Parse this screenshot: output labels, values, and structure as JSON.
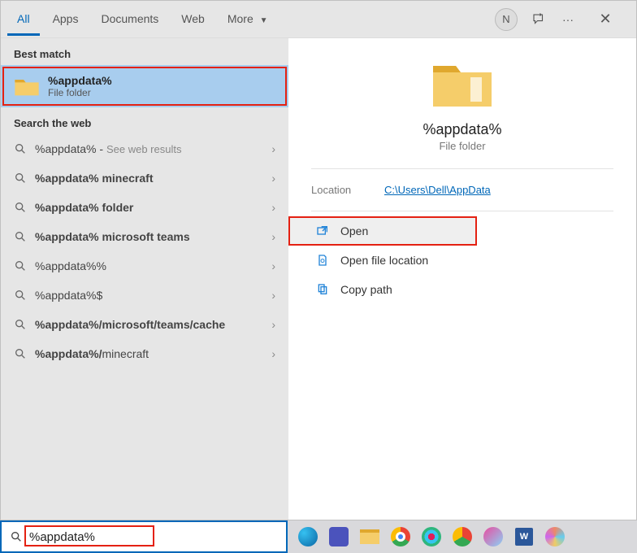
{
  "tabs": {
    "all": "All",
    "apps": "Apps",
    "documents": "Documents",
    "web": "Web",
    "more": "More"
  },
  "titlebar": {
    "avatar_initial": "N"
  },
  "sections": {
    "best_match": "Best match",
    "search_web": "Search the web"
  },
  "best_match": {
    "title": "%appdata%",
    "subtitle": "File folder"
  },
  "results": [
    {
      "label": "%appdata%",
      "hint": "See web results"
    },
    {
      "label": "%appdata% minecraft"
    },
    {
      "label": "%appdata% folder"
    },
    {
      "label": "%appdata% microsoft teams"
    },
    {
      "label": "%appdata%%"
    },
    {
      "label": "%appdata%$"
    },
    {
      "label": "%appdata%/microsoft/teams/cache"
    },
    {
      "label": "%appdata%/minecraft"
    }
  ],
  "preview": {
    "title": "%appdata%",
    "subtitle": "File folder",
    "location_label": "Location",
    "location_value": "C:\\Users\\Dell\\AppData"
  },
  "actions": {
    "open": "Open",
    "open_file_location": "Open file location",
    "copy_path": "Copy path"
  },
  "search": {
    "value": "%appdata%"
  },
  "colors": {
    "accent": "#0067b8",
    "highlight": "#e42112",
    "selection": "#a8cdee"
  }
}
